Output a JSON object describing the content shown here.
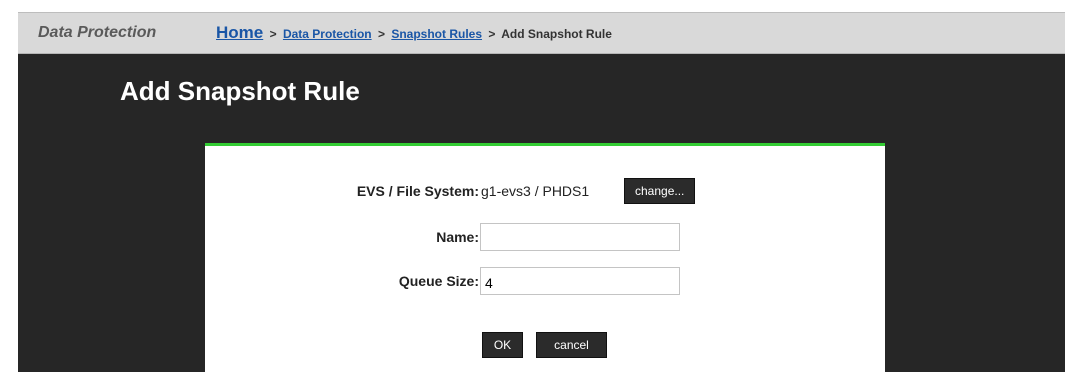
{
  "header": {
    "section_title": "Data Protection",
    "breadcrumb": {
      "home": "Home",
      "items": [
        "Data Protection",
        "Snapshot Rules"
      ],
      "current": "Add Snapshot Rule",
      "separator": ">"
    }
  },
  "page": {
    "title": "Add Snapshot Rule"
  },
  "form": {
    "evs_label": "EVS / File System:",
    "evs_value": "g1-evs3 /  PHDS1",
    "change_button": "change...",
    "name_label": "Name:",
    "name_value": "",
    "queue_label": "Queue Size:",
    "queue_value": "4",
    "ok_button": "OK",
    "cancel_button": "cancel"
  },
  "colors": {
    "accent_bar": "#33cc33",
    "link": "#1a56a6",
    "background": "#262626"
  }
}
